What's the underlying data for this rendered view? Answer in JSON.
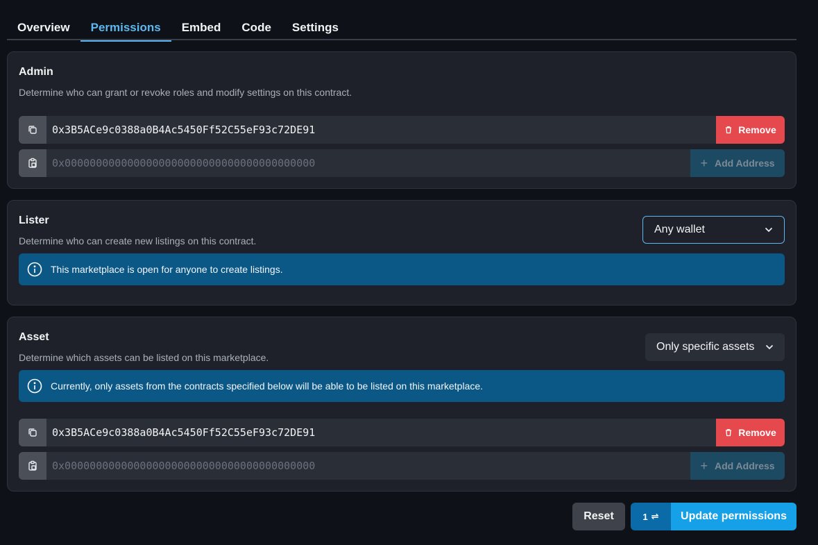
{
  "tabs": [
    {
      "label": "Overview",
      "active": false
    },
    {
      "label": "Permissions",
      "active": true
    },
    {
      "label": "Embed",
      "active": false
    },
    {
      "label": "Code",
      "active": false
    },
    {
      "label": "Settings",
      "active": false
    }
  ],
  "admin": {
    "title": "Admin",
    "description": "Determine who can grant or revoke roles and modify settings on this contract.",
    "address": "0x3B5ACe9c0388a0B4Ac5450Ff52C55eF93c72DE91",
    "remove_label": "Remove",
    "placeholder": "0x0000000000000000000000000000000000000000",
    "add_label": "Add Address"
  },
  "lister": {
    "title": "Lister",
    "description": "Determine who can create new listings on this contract.",
    "select_value": "Any wallet",
    "info": "This marketplace is open for anyone to create listings."
  },
  "asset": {
    "title": "Asset",
    "description": "Determine which assets can be listed on this marketplace.",
    "select_value": "Only specific assets",
    "info": "Currently, only assets from the contracts specified below will be able to be listed on this marketplace.",
    "address": "0x3B5ACe9c0388a0B4Ac5450Ff52C55eF93c72DE91",
    "remove_label": "Remove",
    "placeholder": "0x0000000000000000000000000000000000000000",
    "add_label": "Add Address"
  },
  "footer": {
    "reset_label": "Reset",
    "change_count": "1",
    "change_icon": "⇌",
    "update_label": "Update permissions"
  },
  "colors": {
    "accent": "#5db8f0",
    "danger": "#e5484d",
    "info_bg": "#0b5886",
    "primary": "#16a0e8"
  }
}
